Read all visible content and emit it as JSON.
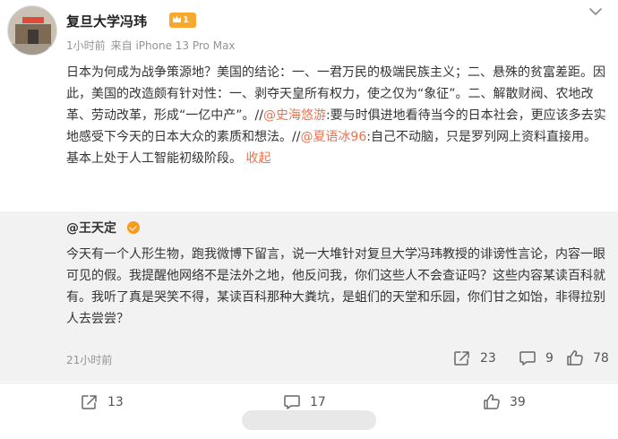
{
  "post": {
    "author": "复旦大学冯玮",
    "level_badge": "1",
    "time": "1小时前",
    "source": "来自 iPhone 13 Pro Max",
    "text": {
      "part1": "日本为何成为战争策源地？美国的结论：一、一君万民的极端民族主义；二、悬殊的贫富差距。因此，美国的改造颇有针对性：一、剥夺天皇所有权力，使之仅为“象征”。二、解散财阀、农地改革、劳动改革，形成“一亿中产”。//",
      "mention1": "@史海悠游",
      "part2": ":要与时俱进地看待当今的日本社会，更应该多去实地感受下今天的日本大众的素质和想法。//",
      "mention2": "@夏语冰96",
      "part3": ":自己不动脑，只是罗列网上资料直接用。基本上处于人工智能初级阶段。",
      "collapse": "收起"
    },
    "actions": {
      "repost_count": "13",
      "comment_count": "17",
      "like_count": "39"
    }
  },
  "repost": {
    "author": "@王天定",
    "text": "今天有一个人形生物，跑我微博下留言，说一大堆针对复旦大学冯玮教授的诽谤性言论，内容一眼可见的假。我提醒他网络不是法外之地，他反问我，你们这些人不会查证吗？这些内容某读百科就有。我听了真是哭笑不得，某读百科那种大粪坑，是蛆们的天堂和乐园，你们甘之如饴，非得拉别人去尝尝？",
    "time": "21小时前",
    "actions": {
      "repost_count": "23",
      "comment_count": "9",
      "like_count": "78"
    }
  },
  "colors": {
    "mention": "#eb7350",
    "verified": "#f89b1b",
    "level_badge": "#f7a82d",
    "repost_bg": "#f2f2f2"
  },
  "icons": [
    "more-chevron-icon",
    "verified-icon",
    "repost-icon",
    "comment-icon",
    "like-icon"
  ]
}
